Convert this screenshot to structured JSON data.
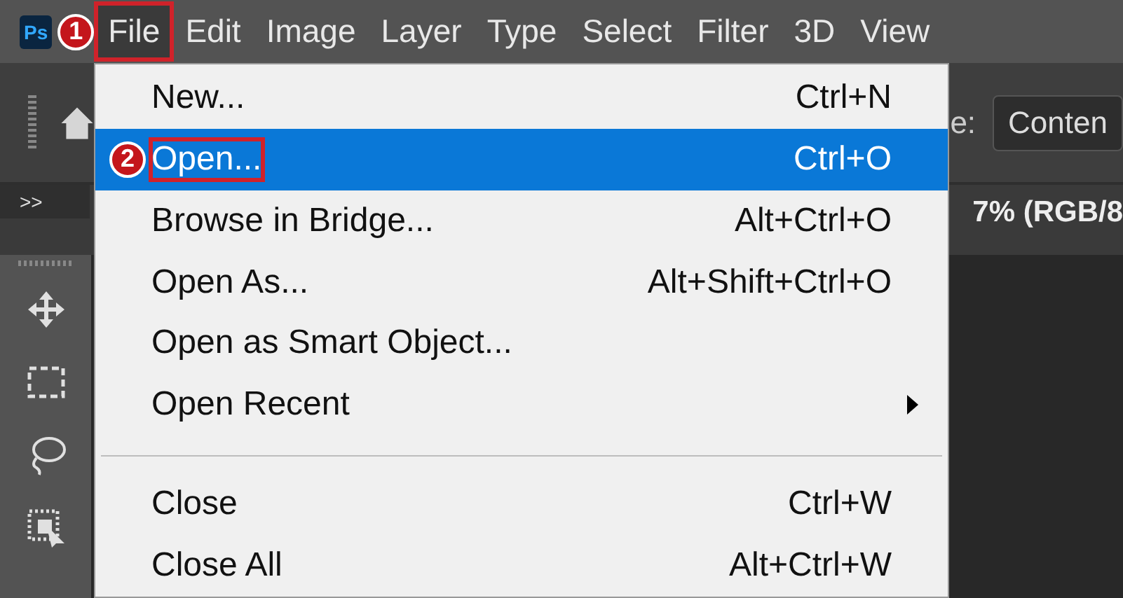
{
  "app_icon": {
    "label": "Ps"
  },
  "menu_bar": [
    {
      "label": "File",
      "selected": true,
      "step": "1"
    },
    {
      "label": "Edit",
      "selected": false
    },
    {
      "label": "Image",
      "selected": false
    },
    {
      "label": "Layer",
      "selected": false
    },
    {
      "label": "Type",
      "selected": false
    },
    {
      "label": "Select",
      "selected": false
    },
    {
      "label": "Filter",
      "selected": false
    },
    {
      "label": "3D",
      "selected": false
    },
    {
      "label": "View",
      "selected": false
    }
  ],
  "file_menu": [
    {
      "kind": "item",
      "label": "New...",
      "shortcut": "Ctrl+N",
      "selected": false
    },
    {
      "kind": "item",
      "label": "Open...",
      "shortcut": "Ctrl+O",
      "selected": true,
      "step": "2"
    },
    {
      "kind": "item",
      "label": "Browse in Bridge...",
      "shortcut": "Alt+Ctrl+O",
      "selected": false
    },
    {
      "kind": "item",
      "label": "Open As...",
      "shortcut": "Alt+Shift+Ctrl+O",
      "selected": false
    },
    {
      "kind": "item",
      "label": "Open as Smart Object...",
      "selected": false
    },
    {
      "kind": "submenu",
      "label": "Open Recent",
      "selected": false
    },
    {
      "kind": "separator"
    },
    {
      "kind": "item",
      "label": "Close",
      "shortcut": "Ctrl+W",
      "selected": false
    },
    {
      "kind": "item",
      "label": "Close All",
      "shortcut": "Alt+Ctrl+W",
      "selected": false
    }
  ],
  "options_bar": {
    "label": "e:",
    "field_value": "Conten"
  },
  "panel_toggle": ">>",
  "document_tab": {
    "title": "7% (RGB/8"
  }
}
